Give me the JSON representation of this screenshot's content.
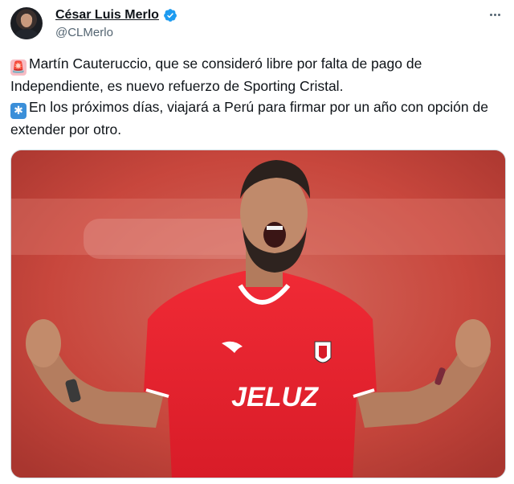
{
  "author": {
    "name": "César Luis Merlo",
    "handle": "@CLMerlo",
    "verified": true
  },
  "tweet": {
    "line1": "Martín Cauteruccio, que se consideró libre por falta de pago de Independiente, es nuevo refuerzo de Sporting Cristal.",
    "line2": "En los próximos días, viajará a Perú para firmar por un año con opción de extender por otro.",
    "emoji1": "siren-emoji",
    "emoji2": "asterisk-emoji"
  },
  "media": {
    "shirt_sponsor": "JELUZ",
    "shirt_brand": "puma",
    "subject": "football-player-celebrating"
  },
  "colors": {
    "verified_blue": "#1d9bf0",
    "handle_gray": "#536471",
    "jersey_red": "#e41f2c"
  }
}
